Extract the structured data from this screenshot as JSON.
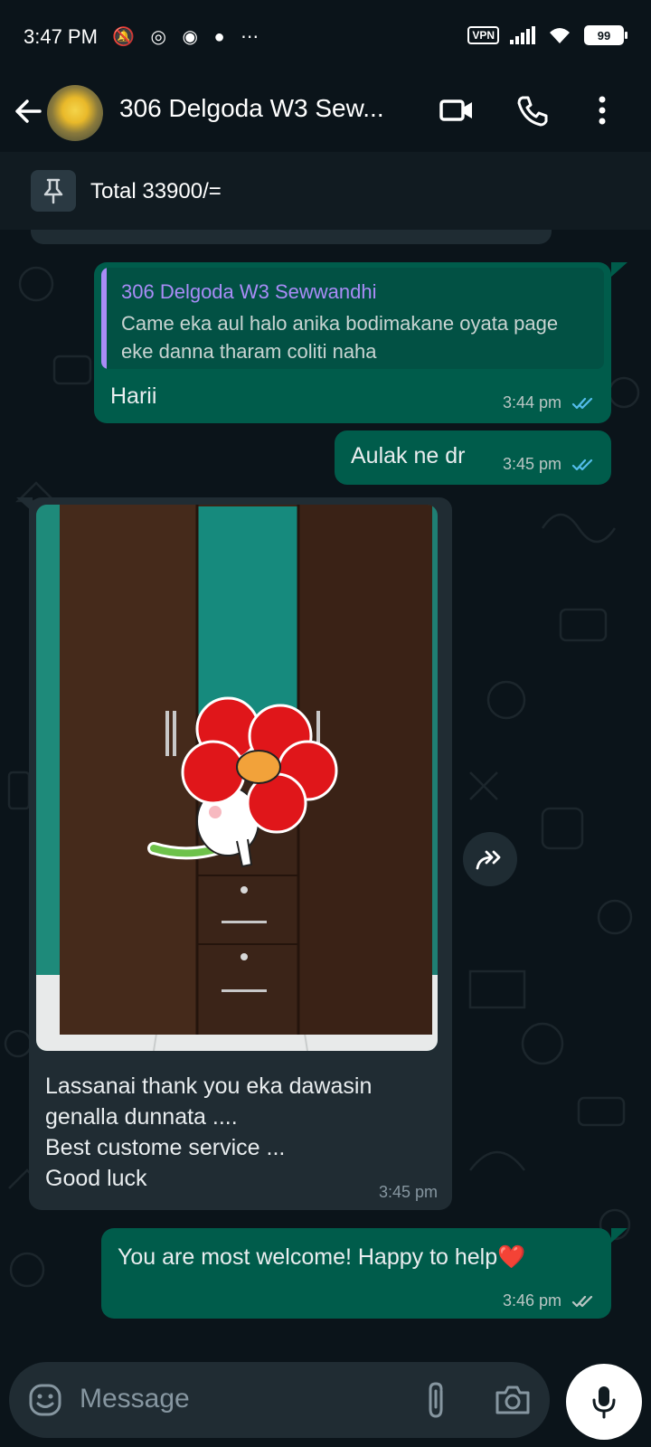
{
  "status_bar": {
    "time": "3:47 PM",
    "icons": [
      "bell-off-icon",
      "whatsapp-icon",
      "messenger-icon",
      "chat-icon",
      "more-dots-icon"
    ],
    "vpn_label": "VPN",
    "battery": "99"
  },
  "header": {
    "title": "306 Delgoda W3 Sew...",
    "icons": [
      "back-arrow-icon",
      "video-call-icon",
      "voice-call-icon",
      "overflow-menu-icon"
    ]
  },
  "pinned": {
    "text": "Total 33900/="
  },
  "messages": [
    {
      "direction": "out",
      "quote_name": "306 Delgoda W3 Sewwandhi",
      "quote_text": "Came eka aul halo anika bodimakane oyata page eke danna tharam coliti naha",
      "text": "Harii",
      "time": "3:44 pm",
      "status": "read"
    },
    {
      "direction": "out",
      "text": "Aulak ne dr",
      "time": "3:45 pm",
      "status": "read"
    },
    {
      "direction": "in",
      "has_photo": true,
      "photo_description_icon": "wardrobe-photo-with-flower-sticker",
      "text_lines": [
        "Lassanai thank you eka dawasin",
        "genalla dunnata ....",
        "Best custome service ...",
        "Good luck"
      ],
      "time": "3:45 pm"
    },
    {
      "direction": "out",
      "text": "You are most welcome! Happy to help❤️",
      "time": "3:46 pm",
      "status": "delivered"
    }
  ],
  "input": {
    "placeholder": "Message",
    "icons": [
      "emoji-icon",
      "attach-icon",
      "camera-icon",
      "mic-icon"
    ]
  },
  "colors": {
    "background": "#0b141a",
    "outgoing_bubble": "#005c4b",
    "incoming_bubble": "#202c33",
    "read_tick": "#53bdeb",
    "quote_name": "#a98cf7"
  }
}
